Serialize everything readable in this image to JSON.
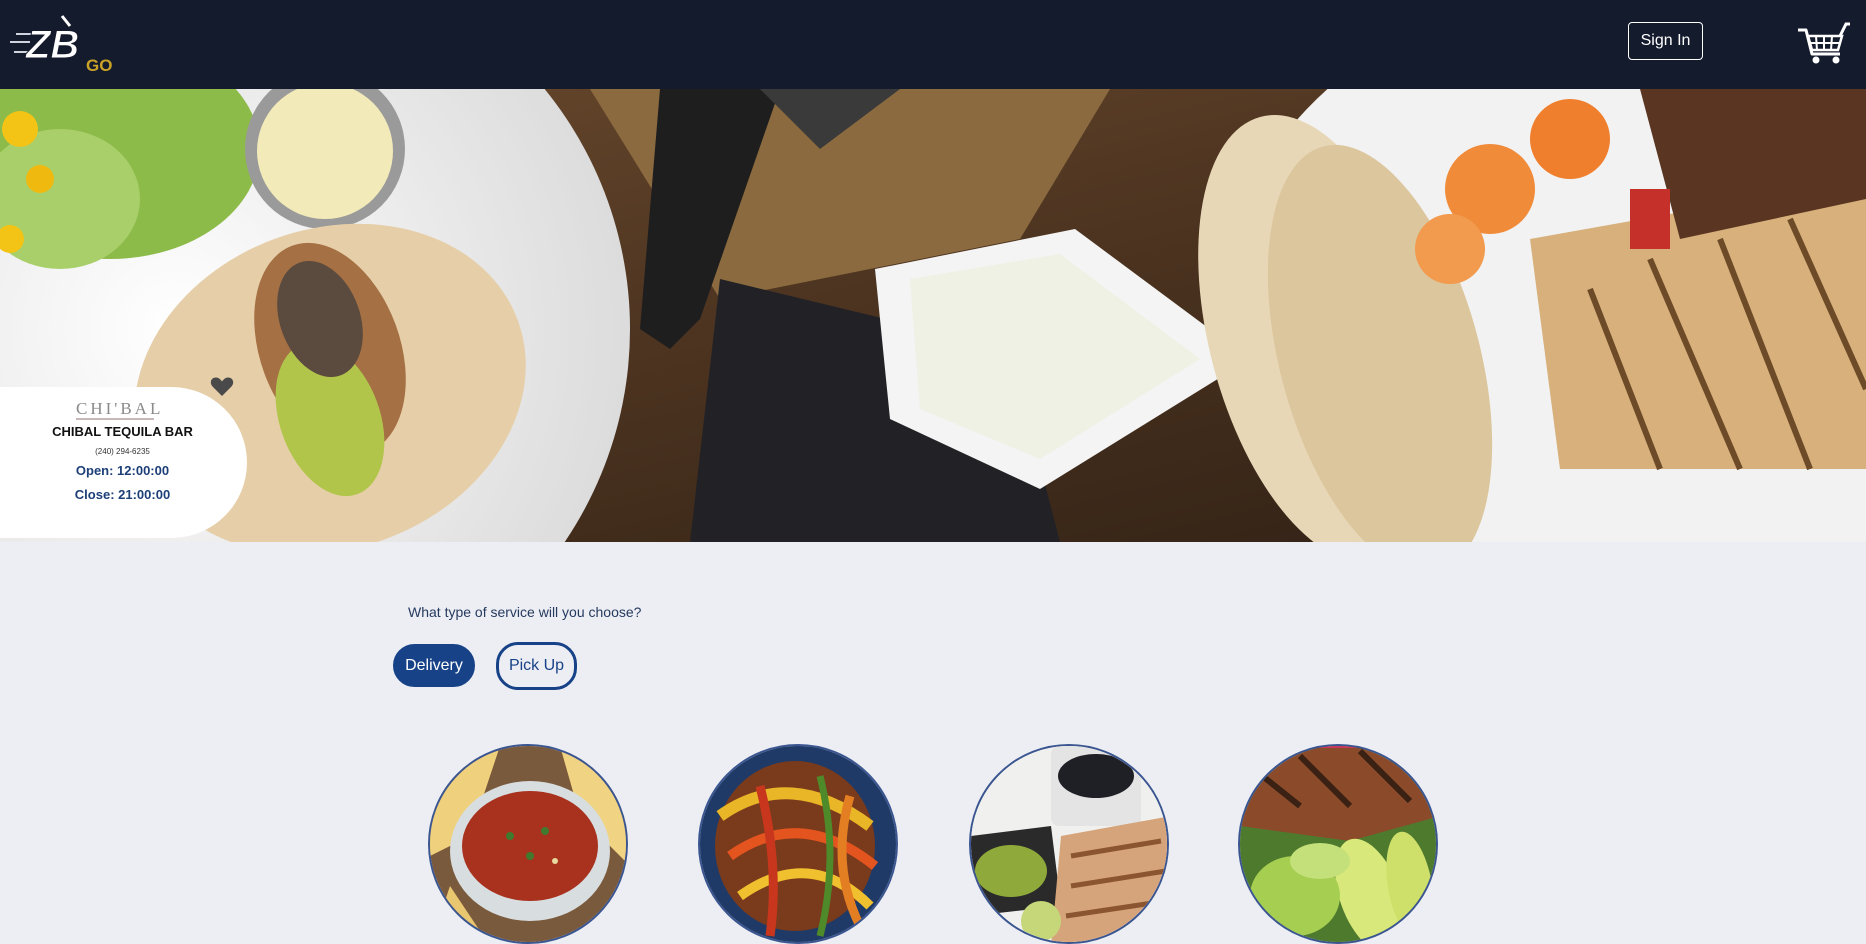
{
  "header": {
    "logo_text": "ZB",
    "logo_go": "GO",
    "signin_label": "Sign In",
    "cart_icon": "shopping-cart-icon"
  },
  "restaurant": {
    "brand_logo": "CHI'BAL",
    "name": "CHIBAL TEQUILA BAR",
    "phone": "(240) 294-6235",
    "open": "Open: 12:00:00",
    "close": "Close: 21:00:00",
    "favorite_icon": "heart-icon"
  },
  "service": {
    "question": "What type of service will you choose?",
    "options": [
      "Delivery",
      "Pick Up"
    ],
    "selected": "Delivery"
  },
  "categories": [
    {
      "image": "salsa-and-chips"
    },
    {
      "image": "fajita-peppers"
    },
    {
      "image": "grilled-chicken-plate"
    },
    {
      "image": "salmon-avocado-salad"
    }
  ],
  "colors": {
    "header_bg": "#141b2c",
    "page_bg": "#eceef4",
    "accent_blue": "#174287",
    "logo_gold": "#c9a227"
  }
}
